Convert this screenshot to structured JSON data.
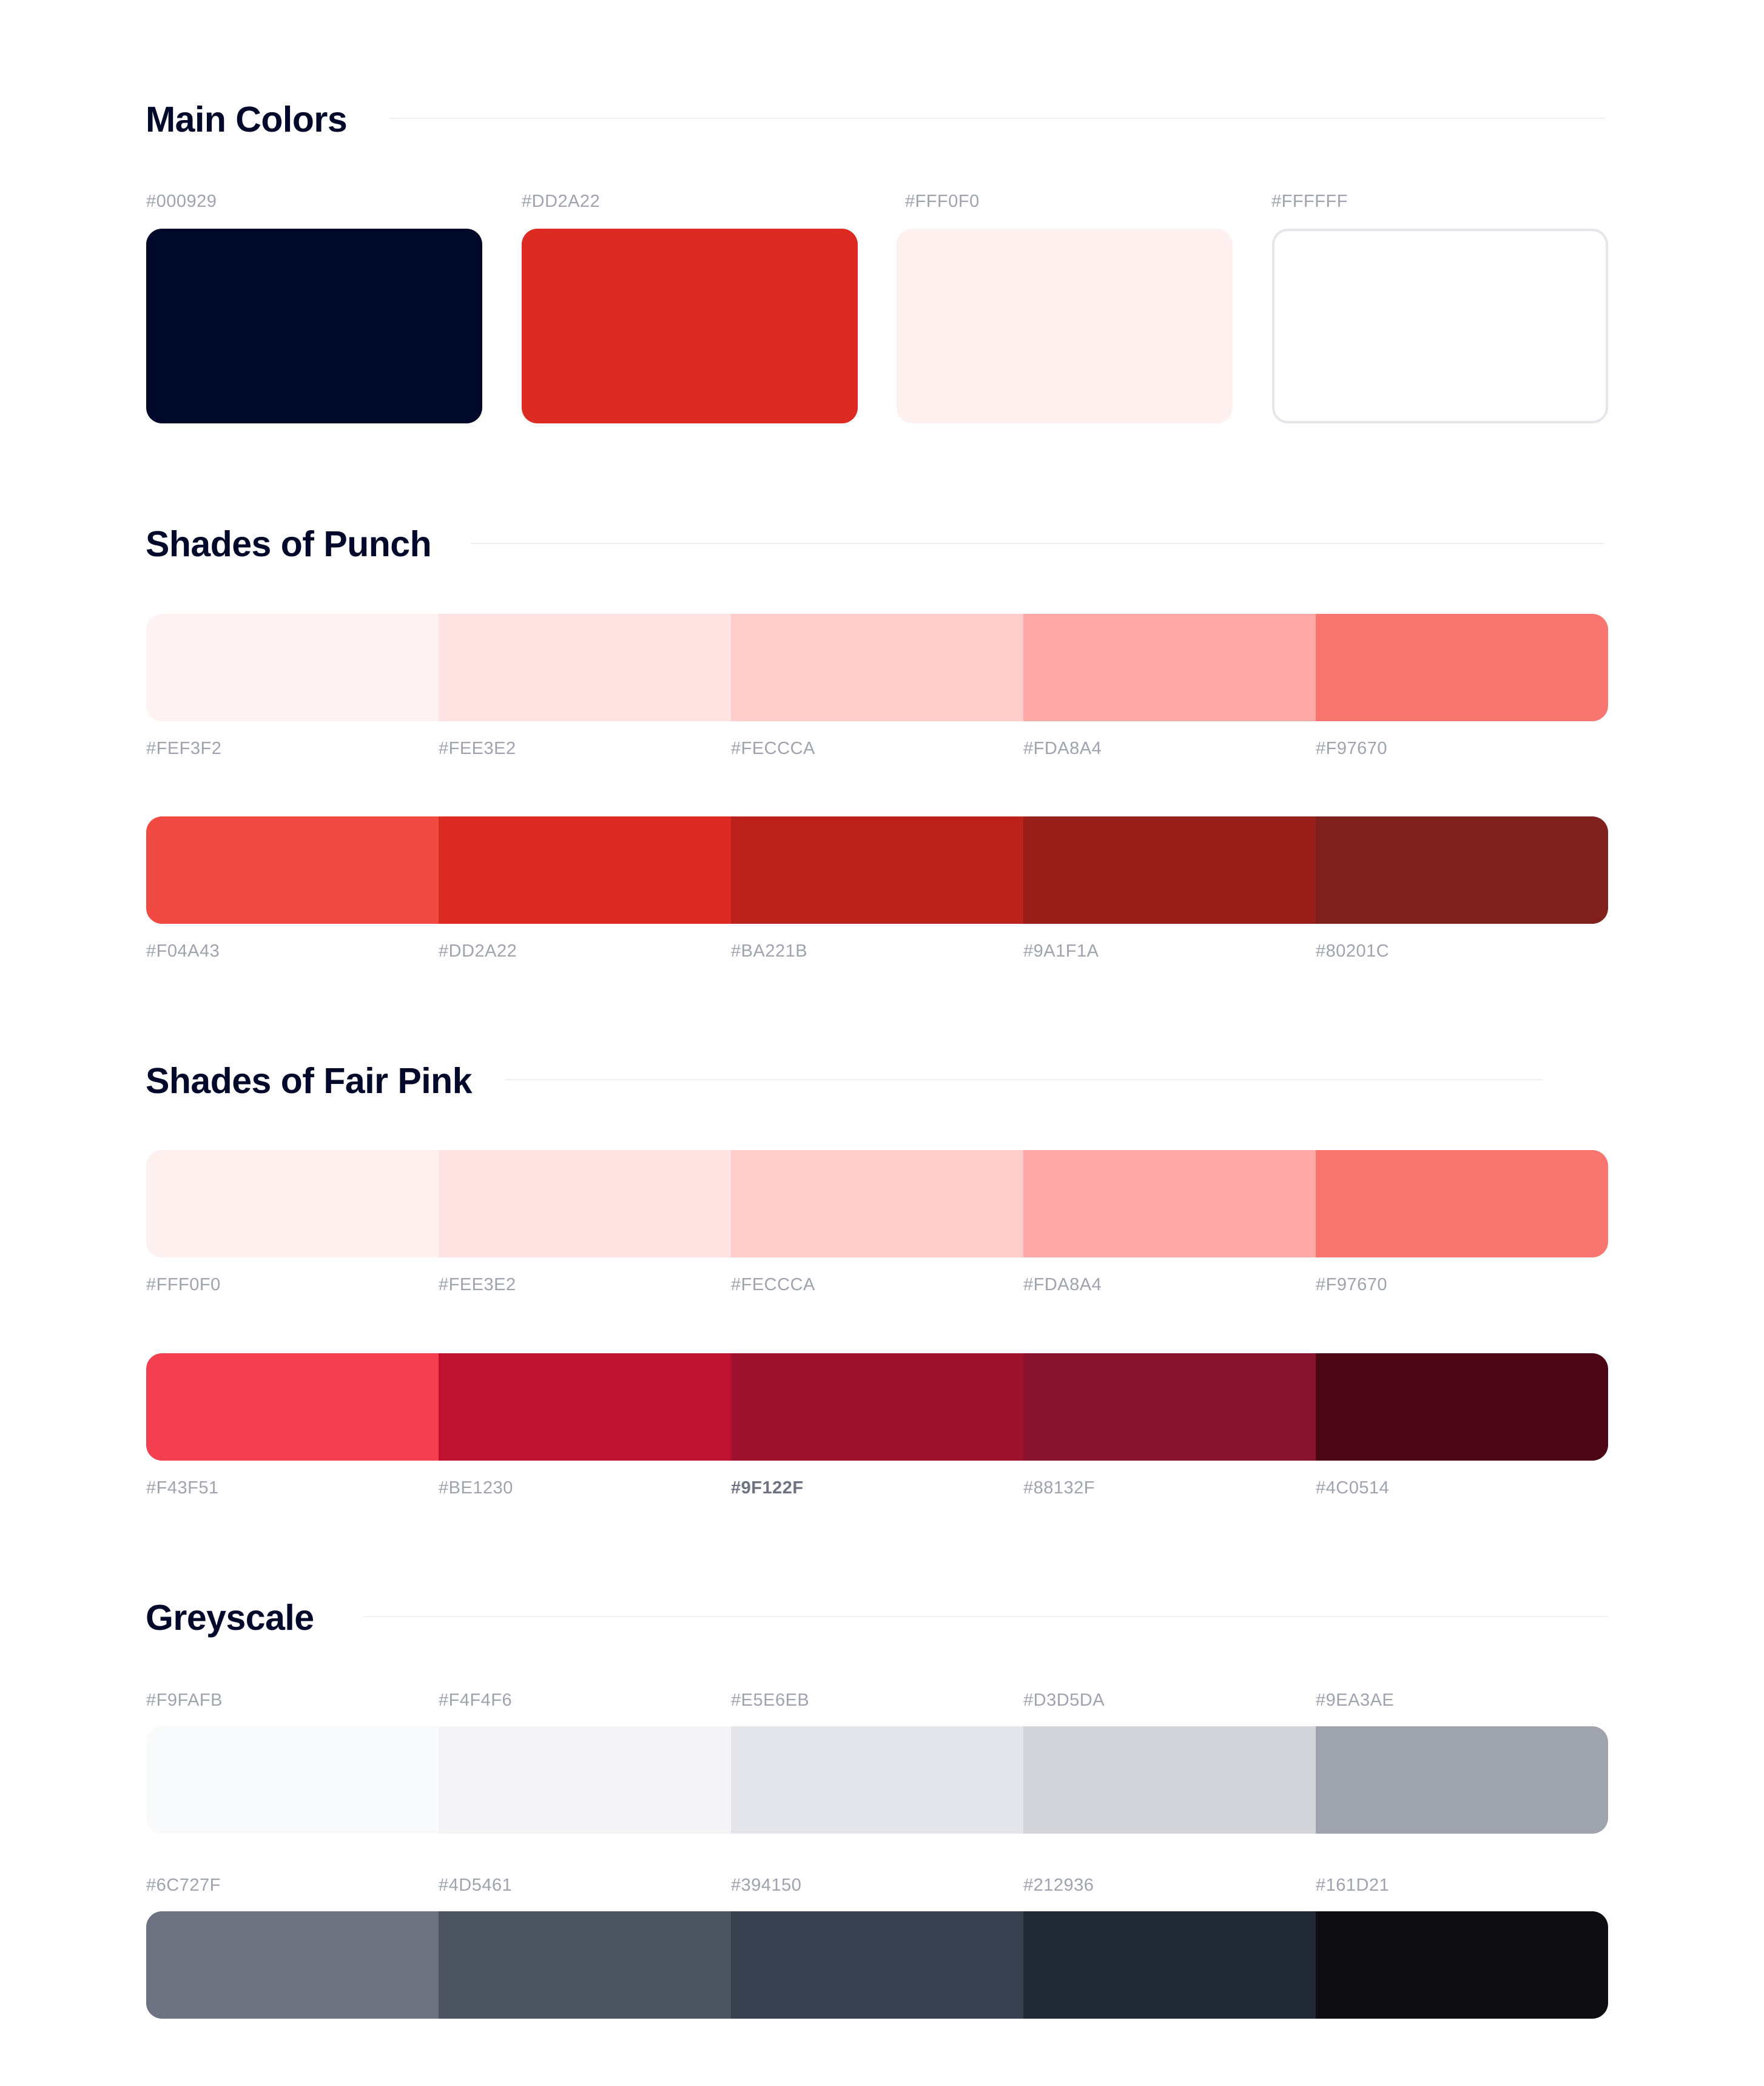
{
  "main": {
    "title": "Main Colors",
    "colors": [
      {
        "hex": "#000929",
        "color": "#000929"
      },
      {
        "hex": "#DD2A22",
        "color": "#DD2A22"
      },
      {
        "hex": "#FFF0F0",
        "color": "#FFF0F0"
      },
      {
        "hex": "#FFFFFF",
        "color": "#FFFFFF"
      }
    ]
  },
  "punch": {
    "title": "Shades of Punch",
    "light": [
      {
        "hex": "#FEF3F2",
        "color": "#FEF3F2"
      },
      {
        "hex": "#FEE3E2",
        "color": "#FEE3E2"
      },
      {
        "hex": "#FECCCA",
        "color": "#FECCCA"
      },
      {
        "hex": "#FDA8A4",
        "color": "#FDA8A4"
      },
      {
        "hex": "#F97670",
        "color": "#F97670"
      }
    ],
    "dark": [
      {
        "hex": "#F04A43",
        "color": "#F04A43"
      },
      {
        "hex": "#DD2A22",
        "color": "#DD2A22"
      },
      {
        "hex": "#BA221B",
        "color": "#BA221B"
      },
      {
        "hex": "#9A1F1A",
        "color": "#9A1F1A"
      },
      {
        "hex": "#80201C",
        "color": "#80201C"
      }
    ]
  },
  "fairpink": {
    "title": "Shades of Fair Pink",
    "light": [
      {
        "hex": "#FFF0F0",
        "color": "#FFF0F0"
      },
      {
        "hex": "#FEE3E2",
        "color": "#FEE3E2"
      },
      {
        "hex": "#FECCCA",
        "color": "#FECCCA"
      },
      {
        "hex": "#FDA8A4",
        "color": "#FDA8A4"
      },
      {
        "hex": "#F97670",
        "color": "#F97670"
      }
    ],
    "dark": [
      {
        "hex": "#F43F51",
        "color": "#F43F51"
      },
      {
        "hex": "#BE1230",
        "color": "#BE1230"
      },
      {
        "hex": "#9F122F",
        "color": "#9F122F"
      },
      {
        "hex": "#88132F",
        "color": "#88132F"
      },
      {
        "hex": "#4C0514",
        "color": "#4C0514"
      }
    ]
  },
  "grey": {
    "title": "Greyscale",
    "light": [
      {
        "hex": "#F9FAFB",
        "color": "#F9FAFB"
      },
      {
        "hex": "#F4F4F6",
        "color": "#F4F4F6"
      },
      {
        "hex": "#E5E6EB",
        "color": "#E5E6EB"
      },
      {
        "hex": "#D3D5DA",
        "color": "#D3D5DA"
      },
      {
        "hex": "#9EA3AE",
        "color": "#9EA3AE"
      }
    ],
    "dark": [
      {
        "hex": "#6C727F",
        "color": "#6C727F"
      },
      {
        "hex": "#4D5461",
        "color": "#4D5461"
      },
      {
        "hex": "#394150",
        "color": "#394150"
      },
      {
        "hex": "#212936",
        "color": "#212936"
      },
      {
        "hex": "#161D21",
        "color": "#0D0D12"
      }
    ]
  },
  "ui": {
    "rule_color": "#EEF0F3",
    "label_color": "#9EA3AE",
    "title_color": "#000929"
  }
}
